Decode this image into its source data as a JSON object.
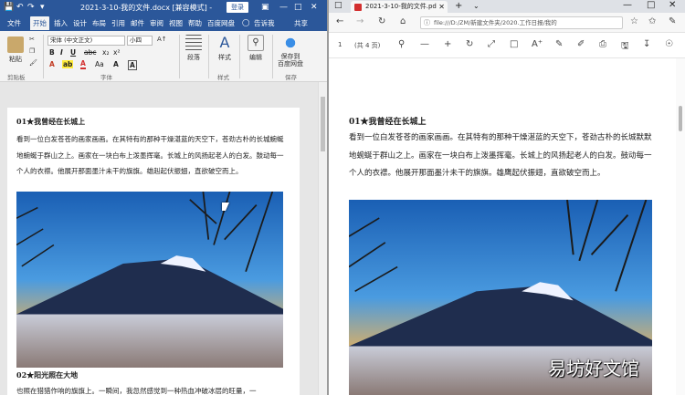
{
  "word": {
    "document_title": "2021-3-10-我的文件.docx [兼容模式] -",
    "login_label": "登录",
    "tabs": [
      {
        "label": "文件",
        "active": false
      },
      {
        "label": "开始",
        "active": true
      },
      {
        "label": "插入",
        "active": false
      },
      {
        "label": "设计",
        "active": false
      },
      {
        "label": "布局",
        "active": false
      },
      {
        "label": "引用",
        "active": false
      },
      {
        "label": "邮件",
        "active": false
      },
      {
        "label": "审阅",
        "active": false
      },
      {
        "label": "视图",
        "active": false
      },
      {
        "label": "帮助",
        "active": false
      },
      {
        "label": "百度网盘",
        "active": false
      },
      {
        "label": "告诉我",
        "active": false
      },
      {
        "label": "共享",
        "active": false
      }
    ],
    "ribbon": {
      "paste_label": "粘贴",
      "font_name": "宋体 (中文正文)",
      "font_size": "小四",
      "paragraph_label": "段落",
      "styles_label": "样式",
      "edit_label": "编辑",
      "save_to_baidu_label": "保存到\n百度网盘",
      "groups": {
        "clipboard": "剪贴板",
        "font": "字体",
        "styles": "样式",
        "save": "保存"
      }
    },
    "body": {
      "heading1": "01★我曾经在长城上",
      "para1": "看到一位白发苍苍的画家画画。在其特有的那种干燥湛蓝的天空下，苍劲古朴的长城蜿蜒地蜿蜒于群山之上。画家在一块白布上泼墨挥毫。长城上的风扬起老人的白发。鼓动每一个人的衣襟。他展开那面墨汁未干的旗旗。雄赳起伏振翅，直欲破空而上。",
      "heading2": "02★阳光照在大地",
      "para2": "也照在猎猎作响的旗旗上。一瞬间，我忽然感觉到一种热血冲破冰层的旺量，一"
    }
  },
  "edge": {
    "tab_title": "2021-3-10-我的文件.pd",
    "url": "file:///D:/ZM/新建文件夹/2020.工作日报/我的",
    "page_number": "1",
    "page_total": "(共 4 页)",
    "body": {
      "heading": "01★我曾经在长城上",
      "para": "看到一位白发苍苍的画家画画。在其特有的那种干燥湛蓝的天空下，苍劲古朴的长城默默地蜿蜒于群山之上。画家在一块白布上泼墨挥毫。长城上的风扬起老人的白发。鼓动每一个人的衣襟。他展开那面墨汁未干的旗旗。雄鹰起伏振翅，直欲破空而上。"
    }
  },
  "watermark": "易坊好文馆",
  "colors": {
    "word_blue": "#2b579a",
    "ribbon_bg": "#f3f3f3",
    "pdf_red": "#d32f2f"
  },
  "icons": {
    "word_save": "save-icon",
    "word_undo": "undo-icon",
    "word_redo": "redo-icon",
    "edge_back": "back-arrow-icon",
    "edge_forward": "forward-arrow-icon",
    "edge_refresh": "refresh-icon",
    "edge_home": "home-icon",
    "edge_favorite": "star-icon",
    "pdf_search": "search-icon",
    "pdf_zoom_out": "minus-icon",
    "pdf_zoom_in": "plus-icon",
    "pdf_rotate": "rotate-icon",
    "pdf_fit": "fit-page-icon",
    "pdf_print": "print-icon",
    "pdf_save": "save-icon"
  }
}
